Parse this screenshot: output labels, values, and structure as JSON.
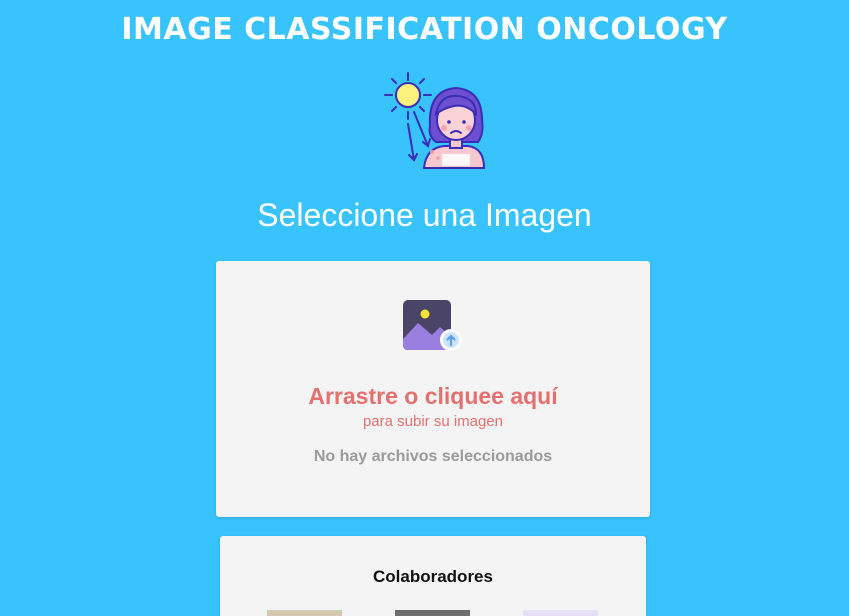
{
  "header": {
    "title": "IMAGE CLASSIFICATION ONCOLOGY"
  },
  "hero": {
    "icon": "patient-sun-exposure-icon"
  },
  "upload": {
    "heading": "Seleccione una Imagen",
    "icon": "image-upload-icon",
    "primary_text": "Arrastre o cliquee aquí",
    "secondary_text": "para subir su imagen",
    "status_text": "No hay archivos seleccionados",
    "accent_color": "#e5706f"
  },
  "collaborators": {
    "title": "Colaboradores",
    "avatars": [
      "avatar",
      "avatar",
      "avatar"
    ]
  },
  "colors": {
    "background": "#38c3fd",
    "card": "#f4f4f4"
  }
}
